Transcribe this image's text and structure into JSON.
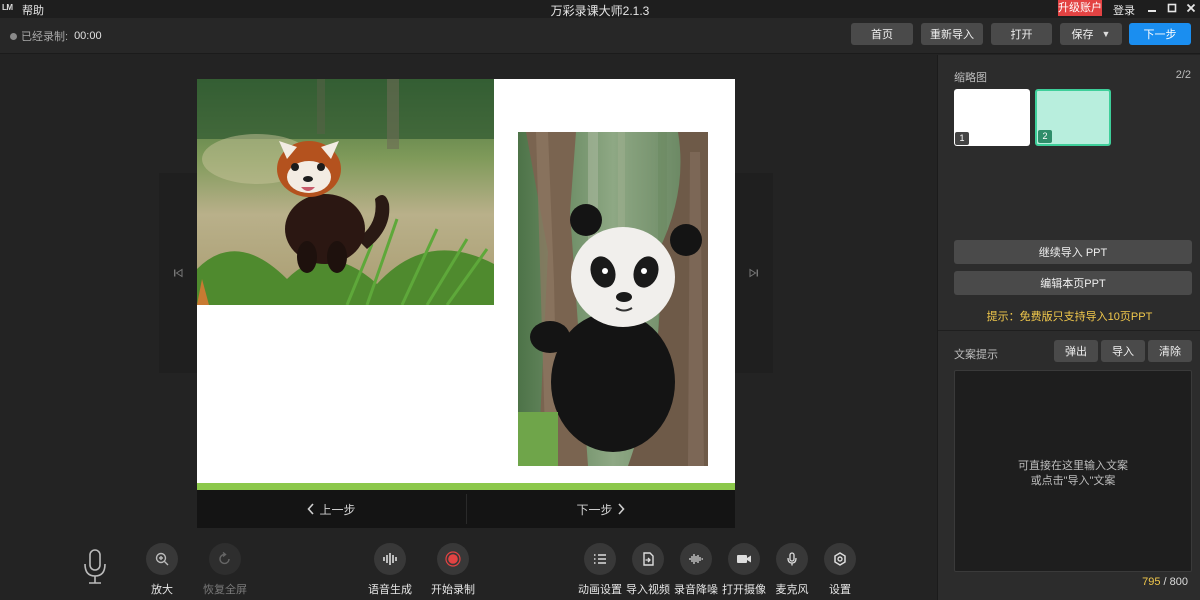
{
  "titlebar": {
    "logo": "LM",
    "help_menu": "帮助",
    "app_title": "万彩录课大师2.1.3",
    "upgrade": "升级账户",
    "login": "登录"
  },
  "toolbar": {
    "rec_label": "已经录制:",
    "rec_time": "00:00",
    "home": "首页",
    "reimport": "重新导入",
    "open": "打开",
    "save": "保存",
    "next": "下一步"
  },
  "slide_nav": {
    "prev": "上一步",
    "next": "下一步"
  },
  "bottom_tools": {
    "zoom_in": "放大",
    "restore_fullscreen": "恢复全屏",
    "voice_gen": "语音生成",
    "start_record": "开始录制",
    "animation": "动画设置",
    "import_video": "导入视频",
    "denoise": "录音降噪",
    "camera": "打开摄像",
    "microphone": "麦克风",
    "settings": "设置"
  },
  "right_panel": {
    "thumbs_title": "缩略图",
    "page_count": "2/2",
    "thumbs": [
      {
        "num": "1",
        "color": "#ffffff"
      },
      {
        "num": "2",
        "color": "#b8eedd"
      }
    ],
    "continue_import": "继续导入 PPT",
    "edit_page": "编辑本页PPT",
    "hint": "提示：免费版只支持导入10页PPT",
    "script_title": "文案提示",
    "popup": "弹出",
    "import": "导入",
    "clear": "清除",
    "placeholder_line1": "可直接在这里输入文案",
    "placeholder_line2": "或点击\"导入\"文案",
    "count_current": "795",
    "count_total": "/ 800"
  },
  "colors": {
    "accent": "#1a8ef0",
    "upgrade": "#e34343",
    "hint": "#f2c94c",
    "slide_stripe": "#8cc84b",
    "thumb_selected_border": "#3ecf9a"
  }
}
